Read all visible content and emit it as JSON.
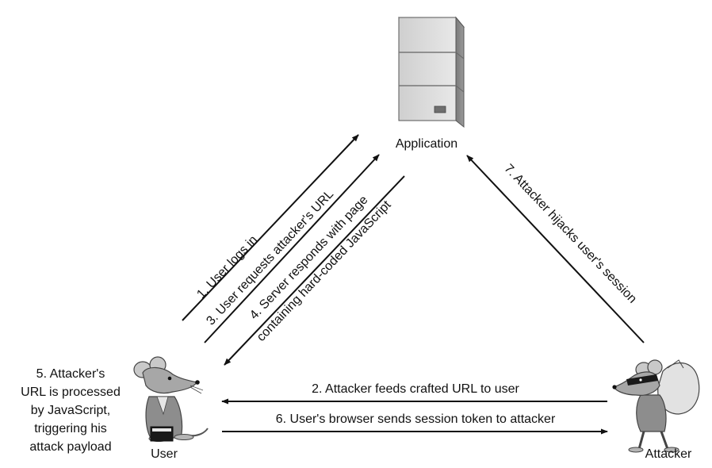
{
  "nodes": {
    "application": "Application",
    "user": "User",
    "attacker": "Attacker"
  },
  "steps": {
    "step1": "1. User logs in",
    "step2": "2. Attacker feeds crafted URL to user",
    "step3": "3. User requests attacker's URL",
    "step4_line1": "4. Server responds with page",
    "step4_line2": "containing hard-coded JavaScript",
    "step6": "6. User's browser sends session token to attacker",
    "step7": "7. Attacker hijacks user's session"
  },
  "note": {
    "line1": "5. Attacker's",
    "line2": "URL is processed",
    "line3": "by JavaScript,",
    "line4": "triggering his",
    "line5": "attack payload"
  },
  "icons": {
    "server": "server-tower-icon",
    "user": "mouse-user-icon",
    "attacker": "masked-mouse-thief-icon"
  },
  "colors": {
    "ink": "#111111",
    "server_light": "#d8d8d8",
    "server_mid": "#a9a9a9",
    "server_dark": "#6f6f6f",
    "mouse_body": "#9a9a9a",
    "mouse_light": "#c9c9c9"
  }
}
